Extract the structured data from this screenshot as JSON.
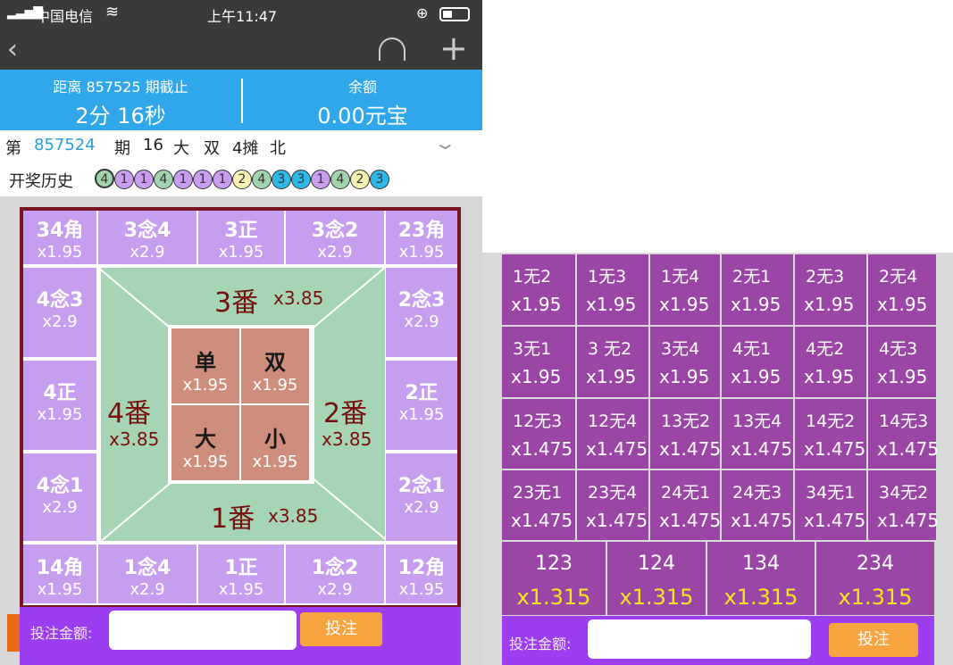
{
  "status_bar": {
    "carrier": "中国电信",
    "time": "上午11:47"
  },
  "countdown": {
    "label": "距离 857525 期截止",
    "value": "2分 16秒"
  },
  "balance": {
    "label": "余额",
    "value": "0.00元宝"
  },
  "issue": {
    "prefix": "第",
    "number": "857524",
    "suffix": "期",
    "num": "16",
    "size": "大",
    "parity": "双",
    "tan": "4摊",
    "dir": "北"
  },
  "history": {
    "label": "开奖历史",
    "balls": [
      "4",
      "1",
      "1",
      "4",
      "1",
      "1",
      "1",
      "2",
      "4",
      "3",
      "3",
      "1",
      "4",
      "2",
      "3"
    ]
  },
  "board": {
    "top": [
      {
        "label": "34角",
        "odds": "x1.95"
      },
      {
        "label": "3念4",
        "odds": "x2.9"
      },
      {
        "label": "3正",
        "odds": "x1.95"
      },
      {
        "label": "3念2",
        "odds": "x2.9"
      },
      {
        "label": "23角",
        "odds": "x1.95"
      }
    ],
    "left": [
      {
        "label": "4念3",
        "odds": "x2.9"
      },
      {
        "label": "4正",
        "odds": "x1.95"
      },
      {
        "label": "4念1",
        "odds": "x2.9"
      }
    ],
    "right": [
      {
        "label": "2念3",
        "odds": "x2.9"
      },
      {
        "label": "2正",
        "odds": "x1.95"
      },
      {
        "label": "2念1",
        "odds": "x2.9"
      }
    ],
    "bottom": [
      {
        "label": "14角",
        "odds": "x1.95"
      },
      {
        "label": "1念4",
        "odds": "x2.9"
      },
      {
        "label": "1正",
        "odds": "x1.95"
      },
      {
        "label": "1念2",
        "odds": "x2.9"
      },
      {
        "label": "12角",
        "odds": "x1.95"
      }
    ],
    "fan": {
      "top": {
        "label": "3番",
        "odds": "x3.85"
      },
      "left": {
        "label": "4番",
        "odds": "x3.85"
      },
      "right": {
        "label": "2番",
        "odds": "x3.85"
      },
      "bottom": {
        "label": "1番",
        "odds": "x3.85"
      }
    },
    "center": [
      {
        "label": "单",
        "odds": "x1.95"
      },
      {
        "label": "双",
        "odds": "x1.95"
      },
      {
        "label": "大",
        "odds": "x1.95"
      },
      {
        "label": "小",
        "odds": "x1.95"
      }
    ]
  },
  "bet": {
    "label": "投注金额:",
    "button": "投注",
    "input_value": ""
  },
  "right_grid": {
    "rows": [
      [
        {
          "label": "1无2",
          "odds": "x1.95"
        },
        {
          "label": "1无3",
          "odds": "x1.95"
        },
        {
          "label": "1无4",
          "odds": "x1.95"
        },
        {
          "label": "2无1",
          "odds": "x1.95"
        },
        {
          "label": "2无3",
          "odds": "x1.95"
        },
        {
          "label": "2无4",
          "odds": "x1.95"
        }
      ],
      [
        {
          "label": "3无1",
          "odds": "x1.95"
        },
        {
          "label": "3 无2",
          "odds": "x1.95"
        },
        {
          "label": "3无4",
          "odds": "x1.95"
        },
        {
          "label": "4无1",
          "odds": "x1.95"
        },
        {
          "label": "4无2",
          "odds": "x1.95"
        },
        {
          "label": "4无3",
          "odds": "x1.95"
        }
      ],
      [
        {
          "label": "12无3",
          "odds": "x1.475"
        },
        {
          "label": "12无4",
          "odds": "x1.475"
        },
        {
          "label": "13无2",
          "odds": "x1.475"
        },
        {
          "label": "13无4",
          "odds": "x1.475"
        },
        {
          "label": "14无2",
          "odds": "x1.475"
        },
        {
          "label": "14无3",
          "odds": "x1.475"
        }
      ],
      [
        {
          "label": "23无1",
          "odds": "x1.475"
        },
        {
          "label": "23无4",
          "odds": "x1.475"
        },
        {
          "label": "24无1",
          "odds": "x1.475"
        },
        {
          "label": "24无3",
          "odds": "x1.475"
        },
        {
          "label": "34无1",
          "odds": "x1.475"
        },
        {
          "label": "34无2",
          "odds": "x1.475"
        }
      ]
    ],
    "triples": [
      {
        "label": "123",
        "odds": "x1.315"
      },
      {
        "label": "124",
        "odds": "x1.315"
      },
      {
        "label": "134",
        "odds": "x1.315"
      },
      {
        "label": "234",
        "odds": "x1.315"
      }
    ]
  },
  "colors": {
    "accent_blue": "#2fa7ea",
    "cell_light_purple": "#c59ef0",
    "cell_dark_purple": "#9b46a6",
    "green": "#a5d5b5",
    "center": "#cf8e7c",
    "button": "#f7a33f",
    "odds_yellow": "#f5e51c"
  }
}
